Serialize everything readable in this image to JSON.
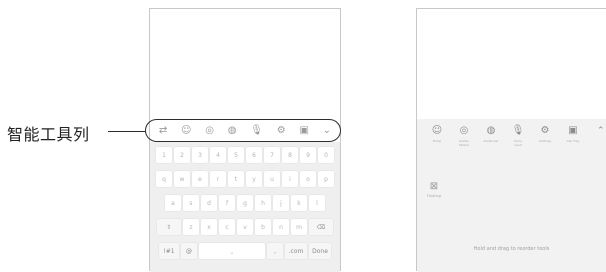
{
  "callout": {
    "label": "智能工具列"
  },
  "left_phone": {
    "toolbar_icons": [
      {
        "icon": "smart-toolbar-icon",
        "glyph": "⇄"
      },
      {
        "icon": "emoji-icon",
        "glyph": "☺"
      },
      {
        "icon": "sticker-icon",
        "glyph": "◎"
      },
      {
        "icon": "gif-icon",
        "glyph": "◍"
      },
      {
        "icon": "mic-icon",
        "glyph": "🎙"
      },
      {
        "icon": "settings-icon",
        "glyph": "⚙"
      },
      {
        "icon": "clipboard-icon",
        "glyph": "▣"
      },
      {
        "icon": "chevron-down-icon",
        "glyph": "⌄"
      }
    ],
    "keyboard": {
      "row1": [
        "1",
        "2",
        "3",
        "4",
        "5",
        "6",
        "7",
        "8",
        "9",
        "0"
      ],
      "row2": [
        "q",
        "w",
        "e",
        "r",
        "t",
        "y",
        "u",
        "i",
        "o",
        "p"
      ],
      "row3": [
        "a",
        "s",
        "d",
        "f",
        "g",
        "h",
        "j",
        "k",
        "l"
      ],
      "row4": [
        "z",
        "x",
        "c",
        "v",
        "b",
        "n",
        "m"
      ],
      "shift": "⇧",
      "backspace": "⌫",
      "sym": "!#1",
      "at": "@",
      "space": "⎵",
      "comma": ",",
      "dotcom": ".com",
      "done": "Done"
    }
  },
  "right_phone": {
    "tools": [
      {
        "icon": "emoji-icon",
        "glyph": "☺",
        "label": "Emoji"
      },
      {
        "icon": "avatar-sticker-icon",
        "glyph": "◎",
        "label": "Avatar\nSticker"
      },
      {
        "icon": "animoji-icon",
        "glyph": "◍",
        "label": "AniSticker"
      },
      {
        "icon": "mic-icon",
        "glyph": "🎙",
        "label": "Voice\ninput"
      },
      {
        "icon": "settings-icon",
        "glyph": "⚙",
        "label": "Settings"
      },
      {
        "icon": "clipboard-icon",
        "glyph": "▣",
        "label": "Clip Tray"
      }
    ],
    "chevron": "⌃",
    "floating": {
      "glyph": "⊠",
      "label": "Floating"
    },
    "hint": "Hold and drag to reorder tools"
  }
}
